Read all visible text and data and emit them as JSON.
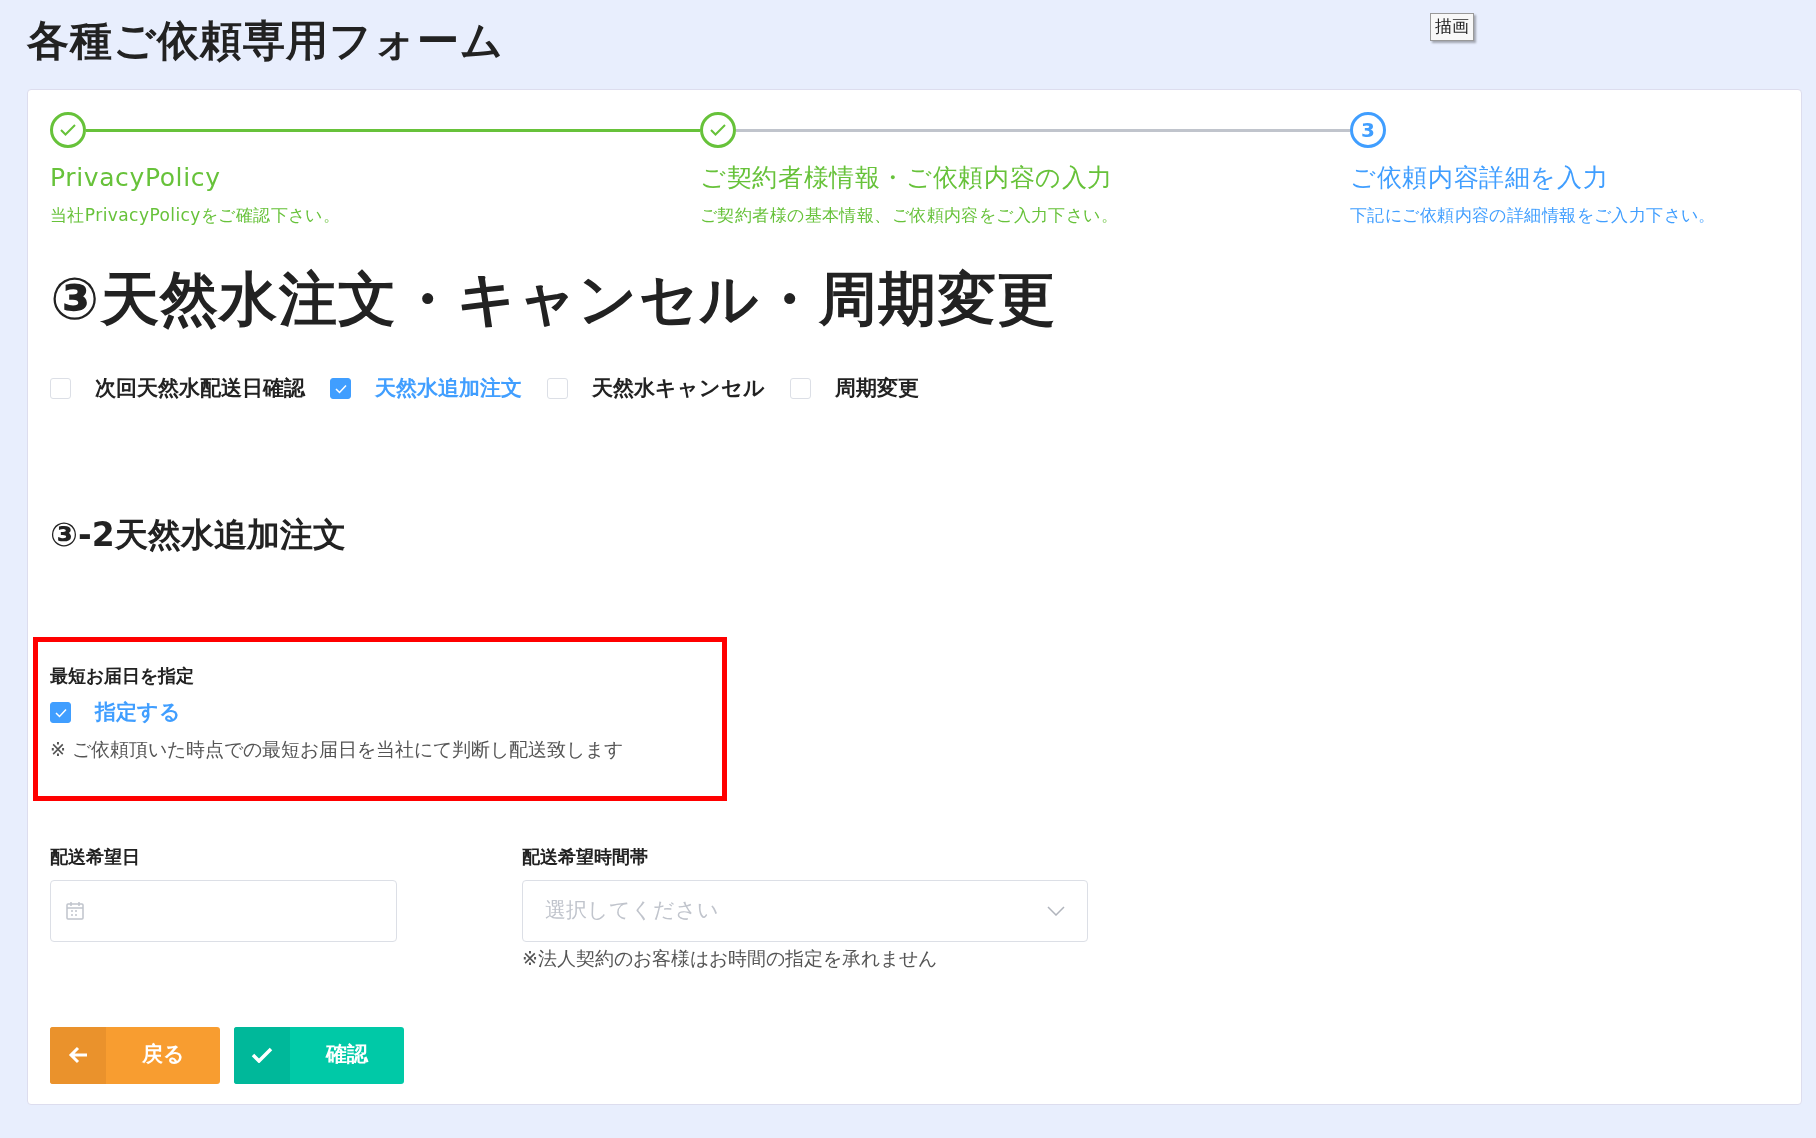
{
  "page_title": "各種ご依頼専用フォーム",
  "tooltip": "描画",
  "steps": [
    {
      "title": "PrivacyPolicy",
      "description": "当社PrivacyPolicyをご確認下さい。",
      "completed": true
    },
    {
      "title": "ご契約者様情報・ご依頼内容の入力",
      "description": "ご契約者様の基本情報、ご依頼内容をご入力下さい。",
      "completed": true
    },
    {
      "number": "3",
      "title": "ご依頼内容詳細を入力",
      "description": "下記にご依頼内容の詳細情報をご入力下さい。",
      "completed": false
    }
  ],
  "section_title": "③天然水注文・キャンセル・周期変更",
  "request_types": [
    {
      "label": "次回天然水配送日確認",
      "checked": false
    },
    {
      "label": "天然水追加注文",
      "checked": true
    },
    {
      "label": "天然水キャンセル",
      "checked": false
    },
    {
      "label": "周期変更",
      "checked": false
    }
  ],
  "subsection_title": "③-2天然水追加注文",
  "earliest_delivery": {
    "label": "最短お届日を指定",
    "option": {
      "label": "指定する",
      "checked": true
    },
    "note": "※ ご依頼頂いた時点での最短お届日を当社にて判断し配送致します"
  },
  "delivery_date": {
    "label": "配送希望日"
  },
  "delivery_time": {
    "label": "配送希望時間帯",
    "placeholder": "選択してください",
    "note": "※法人契約のお客様はお時間の指定を承れません"
  },
  "buttons": [
    {
      "label": "戻る",
      "kind": "back"
    },
    {
      "label": "確認",
      "kind": "confirm"
    }
  ]
}
